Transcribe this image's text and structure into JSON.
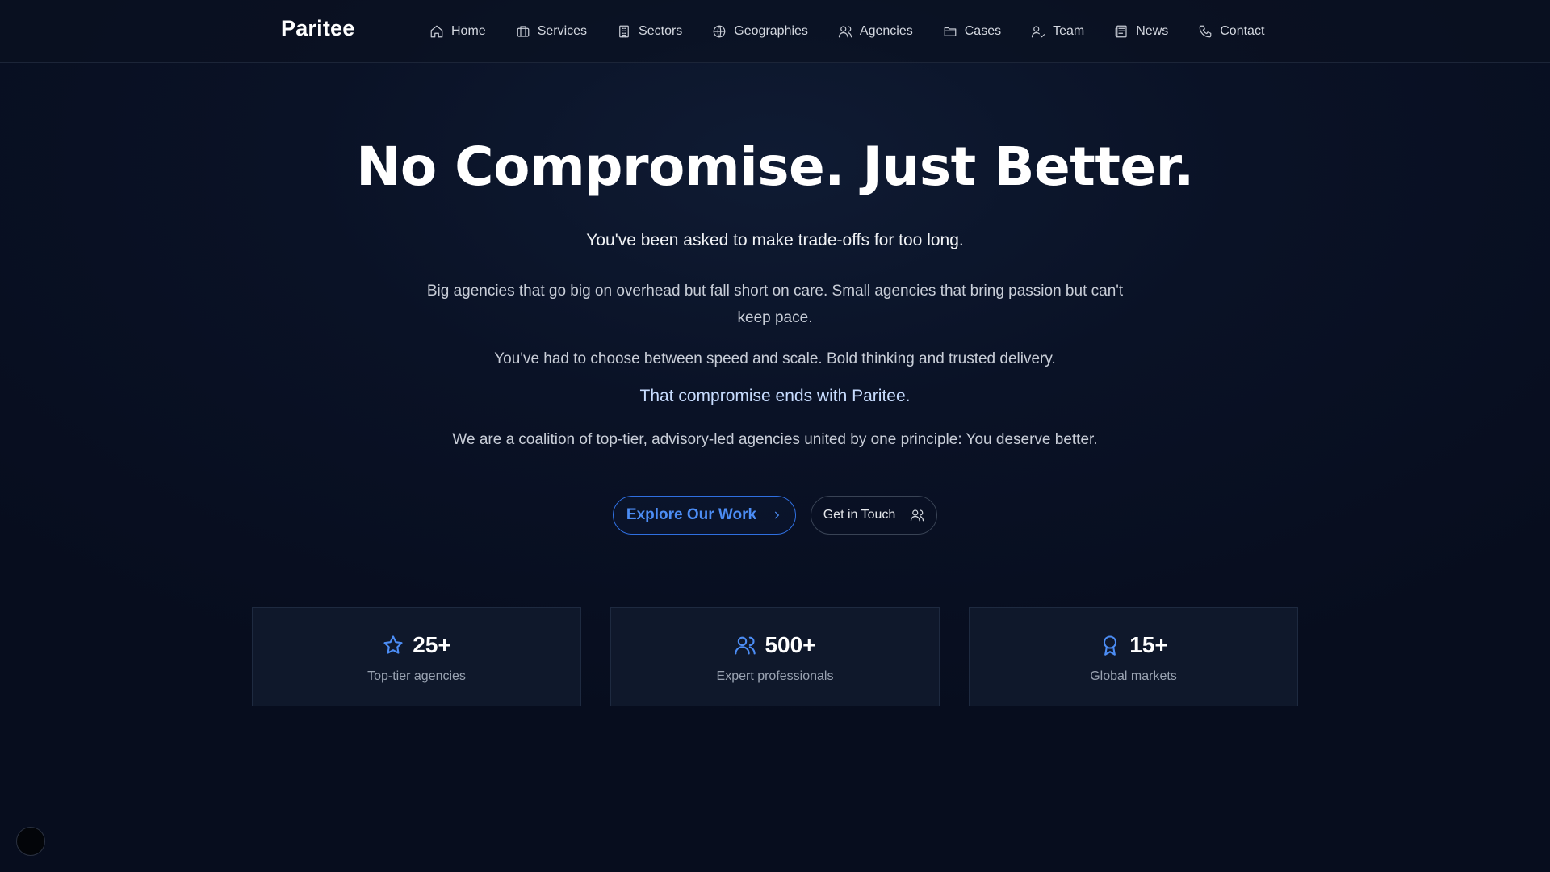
{
  "brand": "Paritee",
  "nav": {
    "items": [
      {
        "label": "Home",
        "icon": "home-icon"
      },
      {
        "label": "Services",
        "icon": "briefcase-icon"
      },
      {
        "label": "Sectors",
        "icon": "building-icon"
      },
      {
        "label": "Geographies",
        "icon": "globe-icon"
      },
      {
        "label": "Agencies",
        "icon": "user-icon"
      },
      {
        "label": "Cases",
        "icon": "folder-icon"
      },
      {
        "label": "Team",
        "icon": "user-check-icon"
      },
      {
        "label": "News",
        "icon": "newspaper-icon"
      },
      {
        "label": "Contact",
        "icon": "phone-icon"
      }
    ]
  },
  "hero": {
    "title": "No Compromise. Just Better.",
    "lead": "You've been asked to make trade-offs for too long.",
    "paragraph1": "Big agencies that go big on overhead but fall short on care. Small agencies that bring passion but can't keep pace.",
    "paragraph2": "You've had to choose between speed and scale. Bold thinking and trusted delivery.",
    "highlight": "That compromise ends with Paritee.",
    "paragraph3": "We are a coalition of top-tier, advisory-led agencies united by one principle: You deserve better."
  },
  "buttons": {
    "primary": "Explore Our Work",
    "secondary": "Get in Touch"
  },
  "stats": [
    {
      "value": "25+",
      "label": "Top-tier agencies",
      "icon": "star-icon"
    },
    {
      "value": "500+",
      "label": "Expert professionals",
      "icon": "users-icon"
    },
    {
      "value": "15+",
      "label": "Global markets",
      "icon": "award-icon"
    }
  ],
  "colors": {
    "accent": "#4c8df5",
    "background": "#0a1226",
    "card": "#0f182b"
  }
}
